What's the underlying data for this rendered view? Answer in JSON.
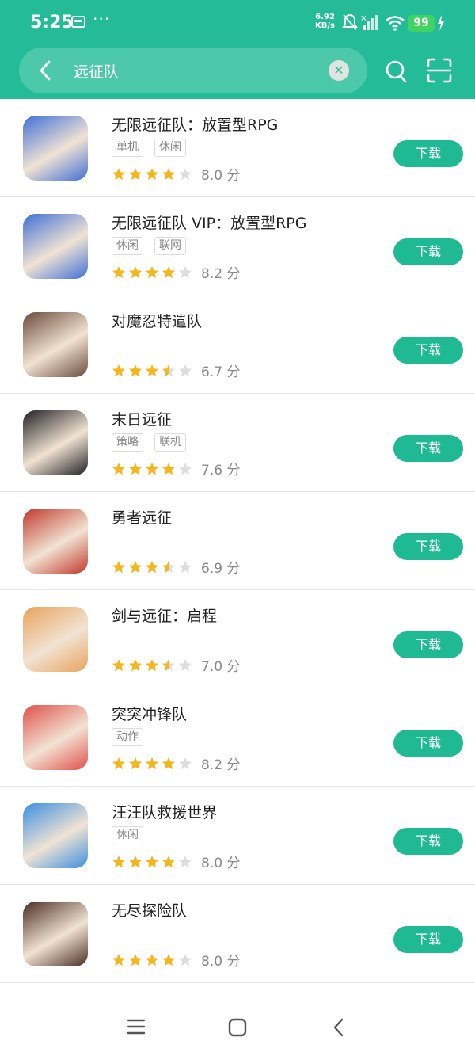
{
  "status": {
    "time": "5:25",
    "dots": "···",
    "speed_value": "6.92",
    "speed_unit": "KB/s",
    "battery": "99"
  },
  "search": {
    "query": "远征队"
  },
  "apps": [
    {
      "name": "无限远征队：放置型RPG",
      "tags": [
        "单机",
        "休闲"
      ],
      "stars": 4,
      "score": "8.0 分",
      "button": "下载",
      "icon": "anime-warrior-icon",
      "accent": "#3f6fd6"
    },
    {
      "name": "无限远征队 VIP：放置型RPG",
      "tags": [
        "休闲",
        "联网"
      ],
      "stars": 4,
      "score": "8.2 分",
      "button": "下载",
      "icon": "anime-warrior-vip-icon",
      "accent": "#3f6fd6"
    },
    {
      "name": "对魔忍特遣队",
      "tags": [],
      "stars": 3.5,
      "score": "6.7 分",
      "button": "下载",
      "icon": "anime-girl-icon",
      "accent": "#6b4a3a"
    },
    {
      "name": "末日远征",
      "tags": [
        "策略",
        "联机"
      ],
      "stars": 4,
      "score": "7.6 分",
      "button": "下载",
      "icon": "amg-logo-icon",
      "accent": "#1f1f24"
    },
    {
      "name": "勇者远征",
      "tags": [],
      "stars": 3.5,
      "score": "6.9 分",
      "button": "下载",
      "icon": "red-monster-icon",
      "accent": "#c0392b"
    },
    {
      "name": "剑与远征：启程",
      "tags": [],
      "stars": 3.5,
      "score": "7.0 分",
      "button": "下载",
      "icon": "windmill-icon",
      "accent": "#e8a35b"
    },
    {
      "name": "突突冲锋队",
      "tags": [
        "动作"
      ],
      "stars": 4,
      "score": "8.2 分",
      "button": "下载",
      "icon": "running-gunner-icon",
      "accent": "#e0504a"
    },
    {
      "name": "汪汪队救援世界",
      "tags": [
        "休闲"
      ],
      "stars": 4,
      "score": "8.0 分",
      "button": "下载",
      "icon": "paw-patrol-icon",
      "accent": "#3a8fe0"
    },
    {
      "name": "无尽探险队",
      "tags": [],
      "stars": 4,
      "score": "8.0 分",
      "button": "下载",
      "icon": "scared-man-icon",
      "accent": "#4a2c22"
    }
  ],
  "colors": {
    "brand": "#24bc98",
    "button": "#1fb994",
    "star": "#f5b51b",
    "star_empty": "#dddddd"
  },
  "icons": {
    "back": "back-arrow-icon",
    "search": "search-icon",
    "scan": "scan-icon",
    "clear": "clear-icon"
  }
}
